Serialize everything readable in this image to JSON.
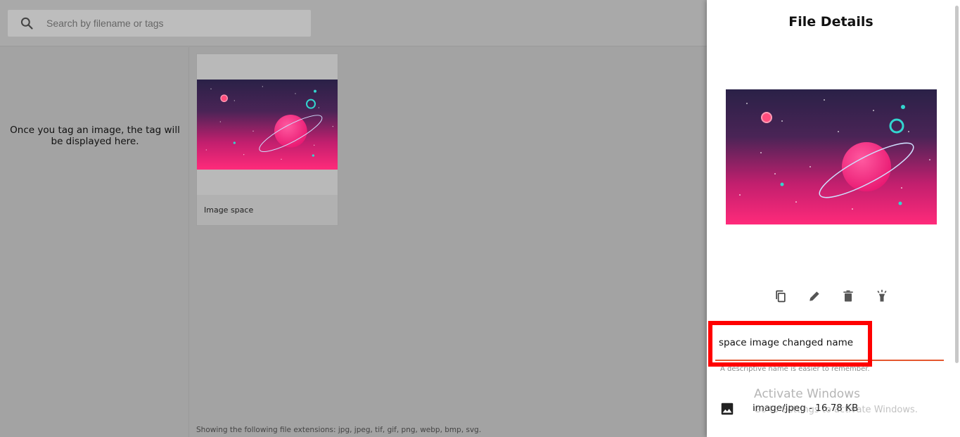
{
  "search": {
    "placeholder": "Search by filename or tags",
    "icon": "search-icon"
  },
  "tags_panel": {
    "empty_message": "Once you tag an image, the tag will be displayed here."
  },
  "files": [
    {
      "name": "Image space",
      "thumbnail": "space-planet-illustration"
    }
  ],
  "footer": {
    "extensions_note": "Showing the following file extensions: jpg, jpeg, tif, gif, png, webp, bmp, svg."
  },
  "details": {
    "title": "File Details",
    "actions": [
      {
        "icon": "copy-icon"
      },
      {
        "icon": "pencil-icon"
      },
      {
        "icon": "trash-icon"
      },
      {
        "icon": "flashlight-icon"
      }
    ],
    "name_input": {
      "value": "space image changed name",
      "helper": "A descriptive name is easier to remember."
    },
    "meta": {
      "icon": "image-icon",
      "text": "image/jpeg - 16.78 KB"
    }
  },
  "watermark": {
    "line1": "Activate Windows",
    "line2": "Go to Settings to activate Windows."
  },
  "colors": {
    "accent_underline": "#e4572e",
    "annotation_box": "#ff0000",
    "overlay_gray": "#a3a3a3"
  }
}
